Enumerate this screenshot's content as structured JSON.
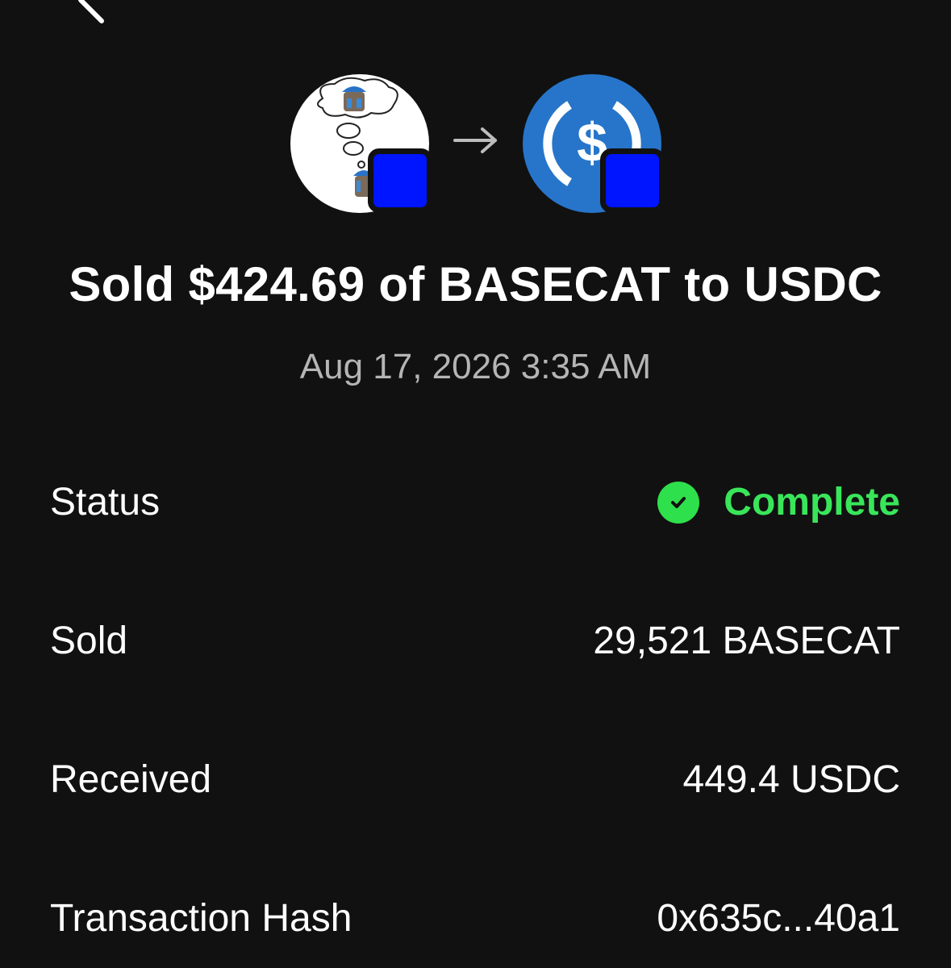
{
  "header": {
    "back_icon": "chevron-left-icon"
  },
  "tokens": {
    "from": {
      "symbol": "BASECAT",
      "icon": "basecat-token-icon"
    },
    "to": {
      "symbol": "USDC",
      "icon": "usdc-token-icon"
    },
    "arrow_icon": "arrow-right-icon",
    "chain_badge_color": "#0015ff",
    "usdc_color": "#2775ca"
  },
  "summary": {
    "title": "Sold $424.69 of BASECAT to USDC",
    "datetime": "Aug 17, 2026 3:35 AM"
  },
  "details": {
    "status": {
      "label": "Status",
      "value": "Complete",
      "icon": "check-circle-icon",
      "color": "#39e65a"
    },
    "sold": {
      "label": "Sold",
      "value": "29,521 BASECAT"
    },
    "received": {
      "label": "Received",
      "value": "449.4 USDC"
    },
    "tx_hash": {
      "label": "Transaction Hash",
      "value": "0x635c...40a1"
    }
  }
}
